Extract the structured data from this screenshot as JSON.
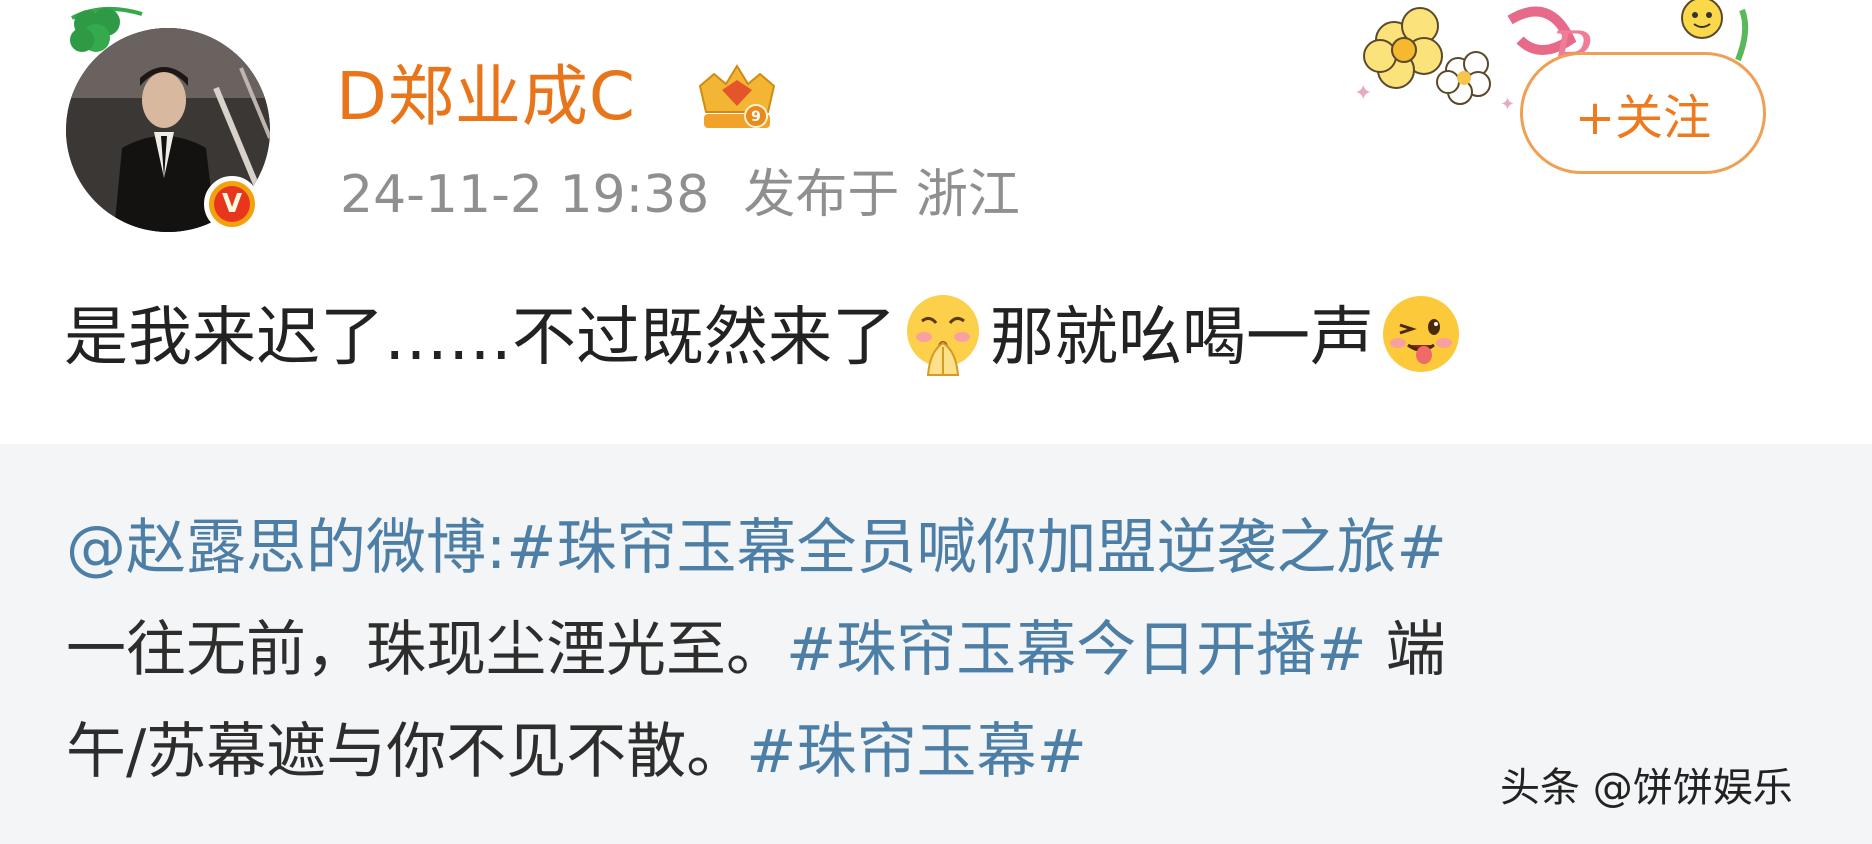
{
  "user": {
    "name": "D郑业成C",
    "avatar_icon": "user-avatar",
    "verified_icon": "verified-v-badge",
    "verified_glyph": "V",
    "level_icon": "crown-level-badge",
    "level_number": "9"
  },
  "meta": {
    "timestamp": "24-11-2 19:38",
    "location_label": "发布于 浙江"
  },
  "follow_button": {
    "label": "+关注"
  },
  "post": {
    "text_part1": "是我来迟了……不过既然来了",
    "emoji1": "praying-shy-emoji",
    "text_part2": "那就吆喝一声",
    "emoji2": "winking-tongue-emoji"
  },
  "repost": {
    "line1_mention": "@赵露思的微博:",
    "line1_hashtag": "#珠帘玉幕全员喊你加盟逆袭之旅#",
    "line2_text": "一往无前，珠现尘湮光至。",
    "line2_hashtag": "#珠帘玉幕今日开播#",
    "line2_tail": " 端",
    "line3_text": "午/苏幕遮与你不见不散。",
    "line3_hashtag": "#珠帘玉幕#"
  },
  "watermark": {
    "text": "头条 @饼饼娱乐"
  },
  "colors": {
    "username": "#e8751a",
    "link": "#4c7ea6",
    "meta": "#8f8f8f",
    "follow": "#ee7a1f",
    "repost_bg": "#f4f5f7"
  }
}
